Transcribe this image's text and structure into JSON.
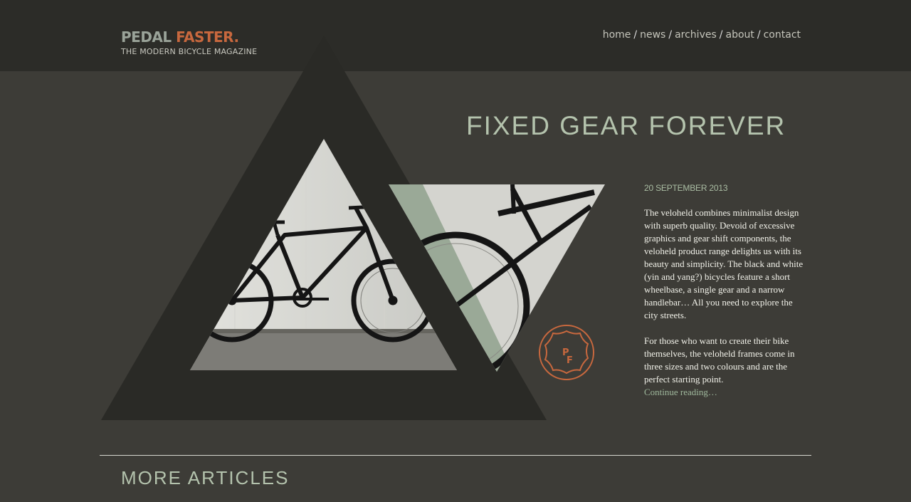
{
  "site": {
    "logo_word1": "PEDAL",
    "logo_word2": "FASTER.",
    "tagline": "THE MODERN BICYCLE MAGAZINE"
  },
  "nav": {
    "items": [
      "home",
      "news",
      "archives",
      "about",
      "contact"
    ],
    "separator": "/"
  },
  "featured": {
    "title": "FIXED GEAR FOREVER",
    "date": "20 SEPTEMBER 2013",
    "paragraphs": [
      "The veloheld combines minimalist design with superb quality. Devoid of excessive graphics and gear shift components, the veloheld product range delights us with its beauty and simplicity. The black and white (yin and yang?) bicycles feature a short wheelbase, a single gear and a narrow handlebar… All you need to explore the city streets.",
      "For those who want to create their bike themselves, the veloheld frames come in three sizes and two colours and are the perfect starting point."
    ],
    "continue_label": "Continue reading…",
    "stamp_letters": [
      "P",
      "F"
    ],
    "photo_icon": "bicycle-photo"
  },
  "more_articles": {
    "heading": "MORE ARTICLES"
  },
  "colors": {
    "background": "#3d3c37",
    "header": "#2c2c28",
    "accent_orange": "#c8683e",
    "accent_green": "#b4c3ad"
  }
}
